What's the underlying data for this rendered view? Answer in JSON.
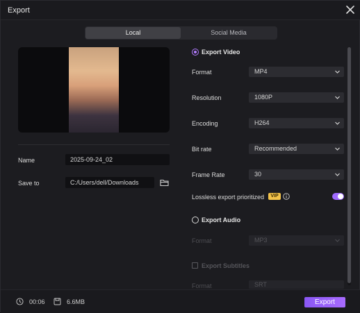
{
  "window": {
    "title": "Export"
  },
  "tabs": [
    {
      "label": "Local",
      "active": true
    },
    {
      "label": "Social Media",
      "active": false
    }
  ],
  "file": {
    "name_label": "Name",
    "name_value": "2025-09-24_02",
    "save_label": "Save to",
    "save_path": "C:/Users/dell/Downloads"
  },
  "video": {
    "section_label": "Export Video",
    "enabled": true,
    "rows": [
      {
        "label": "Format",
        "value": "MP4"
      },
      {
        "label": "Resolution",
        "value": "1080P"
      },
      {
        "label": "Encoding",
        "value": "H264"
      },
      {
        "label": "Bit rate",
        "value": "Recommended"
      },
      {
        "label": "Frame Rate",
        "value": "30"
      }
    ],
    "lossless_label": "Lossless export prioritized",
    "vip_badge": "VIP",
    "lossless_on": true
  },
  "audio": {
    "section_label": "Export Audio",
    "enabled": false,
    "format_label": "Format",
    "format_value": "MP3"
  },
  "subtitles": {
    "section_label": "Export Subtitles",
    "enabled": false,
    "format_label": "Format",
    "format_value": "SRT"
  },
  "footer": {
    "duration": "00:06",
    "size": "6.6MB",
    "export_label": "Export"
  },
  "colors": {
    "accent": "#a06bff",
    "background": "#1c1c20",
    "vip": "#f3c34a"
  },
  "icons": [
    "close-icon",
    "folder-icon",
    "chevron-down-icon",
    "info-icon",
    "clock-icon",
    "file-size-icon"
  ]
}
